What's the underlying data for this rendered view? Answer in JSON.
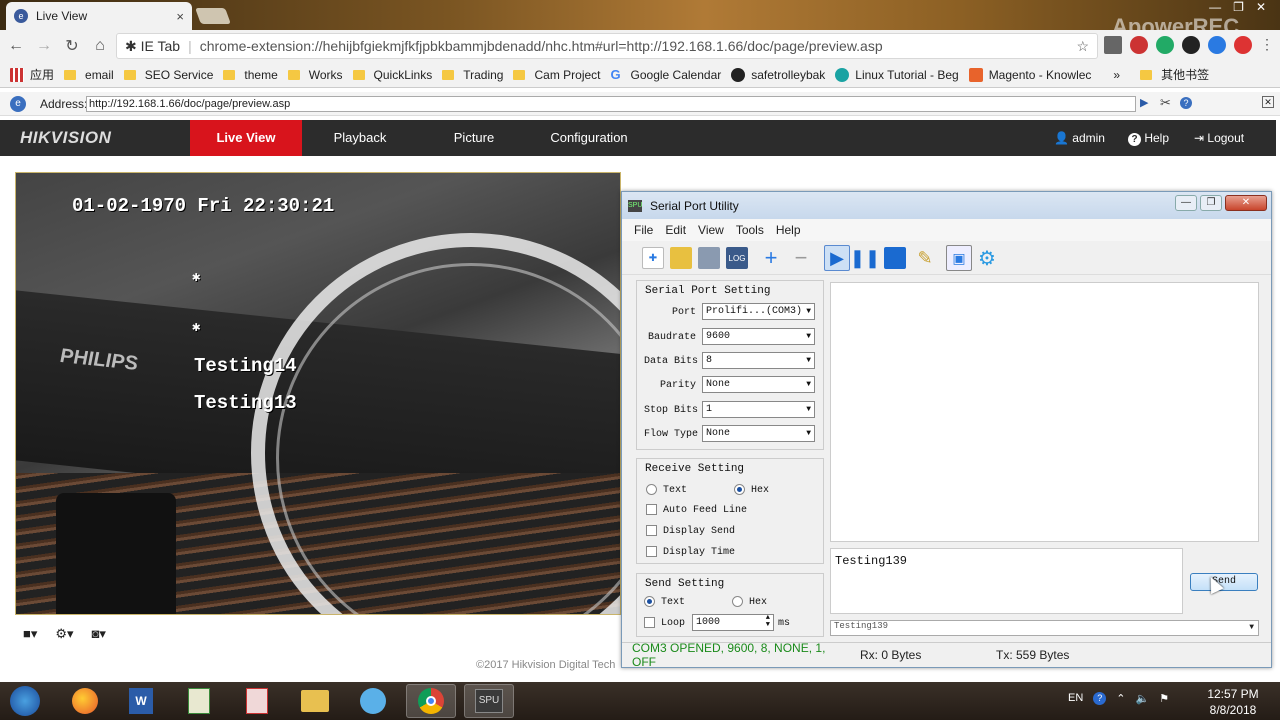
{
  "browser": {
    "tab_title": "Live View",
    "tab_close": "×",
    "ie_tab_label": "IE Tab",
    "url": "chrome-extension://hehijbfgiekmjfkfjpbkbammjbdenadd/nhc.htm#url=http://192.168.1.66/doc/page/preview.asp",
    "watermark": "ApowerREC",
    "bookmarks": [
      {
        "label": "应用",
        "icon": "apps-grid-icon"
      },
      {
        "label": "email",
        "icon": "folder-icon"
      },
      {
        "label": "SEO Service",
        "icon": "folder-icon"
      },
      {
        "label": "theme",
        "icon": "folder-icon"
      },
      {
        "label": "Works",
        "icon": "folder-icon"
      },
      {
        "label": "QuickLinks",
        "icon": "folder-icon"
      },
      {
        "label": "Trading",
        "icon": "folder-icon"
      },
      {
        "label": "Cam Project",
        "icon": "folder-icon"
      },
      {
        "label": "Google Calendar",
        "icon": "google-icon"
      },
      {
        "label": "safetrolleybak",
        "icon": "site-icon"
      },
      {
        "label": "Linux Tutorial - Beg",
        "icon": "site-icon"
      },
      {
        "label": "Magento - Knowlec",
        "icon": "magento-icon"
      }
    ],
    "bookmarks_more": "»",
    "other_bookmarks": "其他书签"
  },
  "iebar": {
    "address_label": "Address:",
    "address_value": "http://192.168.1.66/doc/page/preview.asp"
  },
  "hik": {
    "logo": "HIKVISION",
    "nav": [
      "Live View",
      "Playback",
      "Picture",
      "Configuration"
    ],
    "user": "admin",
    "help": "Help",
    "logout": "Logout",
    "copyright": "©2017 Hikvision Digital Tech"
  },
  "video": {
    "timestamp": "01-02-1970 Fri 22:30:21",
    "osd_star1": "✱",
    "osd_star2": "✱",
    "osd_line1": "Testing14",
    "osd_line2": "Testing13",
    "brand_text": "PHILIPS"
  },
  "spu": {
    "title": "Serial Port Utility",
    "menu": [
      "File",
      "Edit",
      "View",
      "Tools",
      "Help"
    ],
    "serial_setting_title": "Serial Port Setting",
    "serial_rows": [
      {
        "label": "Port",
        "value": "Prolifi...(COM3)"
      },
      {
        "label": "Baudrate",
        "value": "9600"
      },
      {
        "label": "Data Bits",
        "value": "8"
      },
      {
        "label": "Parity",
        "value": "None"
      },
      {
        "label": "Stop Bits",
        "value": "1"
      },
      {
        "label": "Flow Type",
        "value": "None"
      }
    ],
    "receive_title": "Receive Setting",
    "receive_text": "Text",
    "receive_hex": "Hex",
    "receive_mode": "Hex",
    "auto_feed": "Auto Feed Line",
    "display_send": "Display Send",
    "display_time": "Display Time",
    "send_title": "Send Setting",
    "send_text": "Text",
    "send_hex": "Hex",
    "send_mode": "Text",
    "loop": "Loop",
    "loop_value": "1000",
    "loop_unit": "ms",
    "send_input": "Testing139",
    "send_button": "Send",
    "history_value": "Testing139",
    "status_open": "COM3 OPENED, 9600, 8, NONE, 1, OFF",
    "status_rx": "Rx: 0 Bytes",
    "status_tx": "Tx: 559 Bytes",
    "status_color": "#1a8a1a"
  },
  "taskbar": {
    "time": "12:57 PM",
    "date": "8/8/2018",
    "lang": "EN",
    "spu_label": "SPU"
  }
}
